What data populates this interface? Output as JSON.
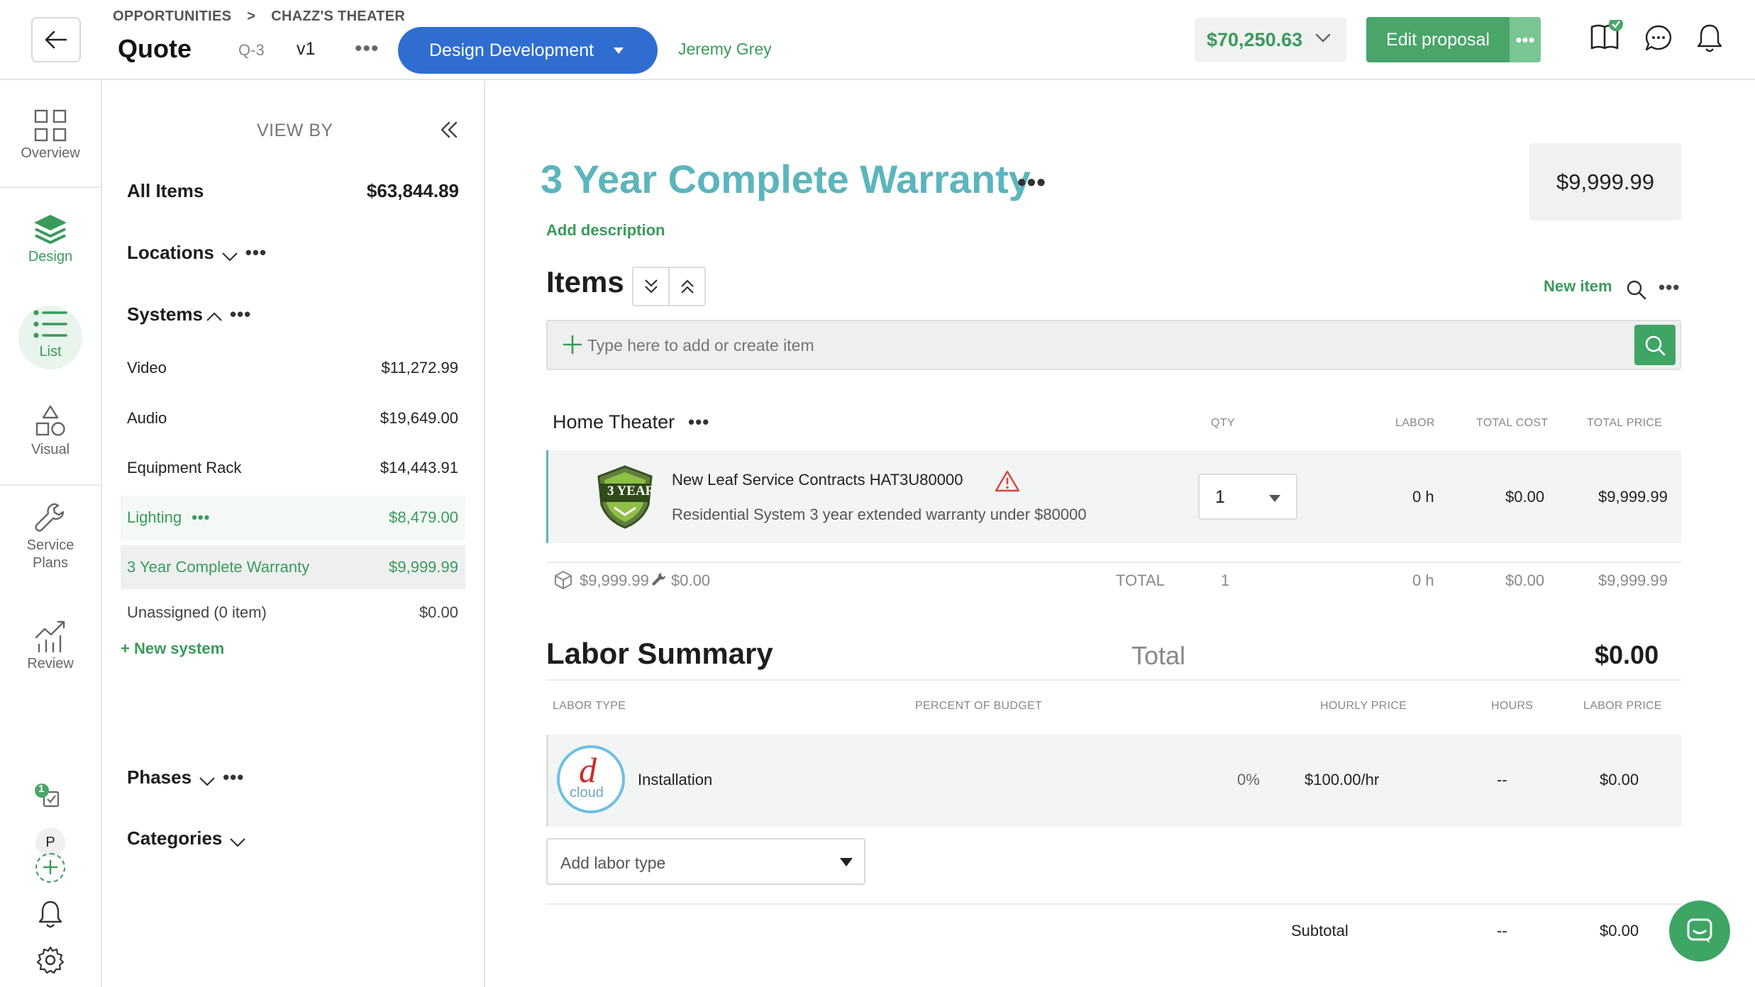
{
  "header": {
    "breadcrumbs": [
      "OPPORTUNITIES",
      ">",
      "CHAZZ'S THEATER"
    ],
    "title": "Quote",
    "quote_number": "Q-3",
    "version": "v1",
    "stage": "Design Development",
    "owner": "Jeremy Grey",
    "total": "$70,250.63",
    "edit_label": "Edit proposal"
  },
  "rail": {
    "items": [
      {
        "label": "Overview",
        "icon": "grid-icon"
      },
      {
        "label": "Design",
        "icon": "layers-icon"
      },
      {
        "label": "List",
        "icon": "list-icon"
      },
      {
        "label": "Visual",
        "icon": "shapes-icon"
      },
      {
        "label": "Service Plans",
        "icon": "wrench-icon"
      },
      {
        "label": "Review",
        "icon": "chart-icon"
      }
    ],
    "task_count": "1",
    "user_initial": "P"
  },
  "panel": {
    "view_by": "VIEW BY",
    "all_items_label": "All Items",
    "all_items_value": "$63,844.89",
    "locations": "Locations",
    "systems": "Systems",
    "system_rows": [
      {
        "name": "Video",
        "value": "$11,272.99"
      },
      {
        "name": "Audio",
        "value": "$19,649.00"
      },
      {
        "name": "Equipment Rack",
        "value": "$14,443.91"
      },
      {
        "name": "Lighting",
        "value": "$8,479.00"
      },
      {
        "name": "3 Year Complete Warranty",
        "value": "$9,999.99"
      },
      {
        "name": "Unassigned (0 item)",
        "value": "$0.00"
      }
    ],
    "new_system": "+ New system",
    "phases": "Phases",
    "categories": "Categories"
  },
  "main": {
    "title": "3 Year Complete Warranty",
    "price": "$9,999.99",
    "add_description": "Add description",
    "items_heading": "Items",
    "new_item": "New item",
    "add_placeholder": "Type here to add or create item",
    "group": "Home Theater",
    "columns": {
      "qty": "QTY",
      "labor": "LABOR",
      "total_cost": "TOTAL COST",
      "total_price": "TOTAL PRICE"
    },
    "item": {
      "badge": "3 YEAR",
      "name": "New Leaf Service Contracts HAT3U80000",
      "description": "Residential System 3 year extended warranty under $80000",
      "qty": "1",
      "labor": "0 h",
      "total_cost": "$0.00",
      "total_price": "$9,999.99"
    },
    "totals": {
      "product": "$9,999.99",
      "labor_cost": "$0.00",
      "label": "TOTAL",
      "qty": "1",
      "labor": "0 h",
      "total_cost": "$0.00",
      "total_price": "$9,999.99"
    }
  },
  "labor": {
    "heading": "Labor Summary",
    "total_label": "Total",
    "total_value": "$0.00",
    "columns": {
      "type": "LABOR TYPE",
      "percent": "PERCENT OF BUDGET",
      "hourly": "HOURLY PRICE",
      "hours": "HOURS",
      "price": "LABOR PRICE"
    },
    "row": {
      "avatar_letter": "d",
      "avatar_text": "cloud",
      "name": "Installation",
      "percent": "0%",
      "hourly": "$100.00/hr",
      "hours": "--",
      "price": "$0.00"
    },
    "add_placeholder": "Add labor type",
    "subtotal_label": "Subtotal",
    "subtotal_hours": "--",
    "subtotal_value": "$0.00"
  },
  "colors": {
    "accent_green": "#3a9a5b",
    "stage_blue": "#2f6ed0",
    "title_teal": "#5bb5bd"
  }
}
